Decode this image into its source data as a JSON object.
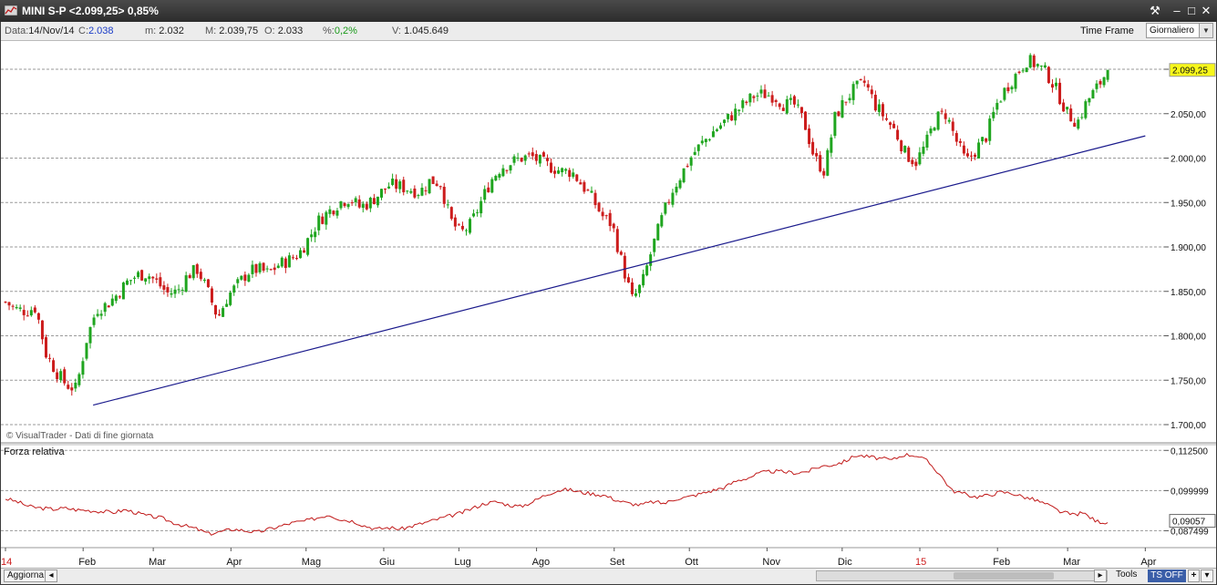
{
  "window": {
    "title": "MINI S-P <2.099,25> 0,85%",
    "buttons": [
      "tools-icon",
      "minimize-icon",
      "maximize-icon",
      "close-icon"
    ]
  },
  "infobar": {
    "date_label": "Data:",
    "date": "14/Nov/14",
    "close_label": "C:",
    "close": "2.038",
    "min_label": "m:",
    "min": "2.032",
    "max_label": "M:",
    "max": "2.039,75",
    "open_label": "O:",
    "open": "2.033",
    "pct_label": "%:",
    "pct": "0,2%",
    "vol_label": "V:",
    "vol": "1.045.649",
    "timeframe_label": "Time Frame",
    "timeframe_value": "Giornaliero"
  },
  "bottombar": {
    "refresh_label": "Aggiorna",
    "tools_label": "Tools",
    "ts_label": "TS OFF",
    "plus_label": "+",
    "menu_label": "▾"
  },
  "colors": {
    "up": "#1fa51f",
    "down": "#cc1c1c",
    "trendline": "#1a1a8c",
    "rs_line": "#c01818",
    "last_price_bg": "#f7f71a",
    "grid": "#9a9a9a"
  },
  "chart_data": [
    {
      "type": "candlestick",
      "watermark": "© VisualTrader - Dati di fine giornata",
      "ylim": [
        1700,
        2120
      ],
      "yticks": [
        "2.100,00",
        "2.050,00",
        "2.000,00",
        "1.950,00",
        "1.900,00",
        "1.850,00",
        "1.800,00",
        "1.750,00",
        "1.700,00"
      ],
      "ytick_values": [
        2100,
        2050,
        2000,
        1950,
        1900,
        1850,
        1800,
        1750,
        1700
      ],
      "last_price": 2099.25,
      "last_price_label": "2.099,25",
      "xticks": [
        "14",
        "Feb",
        "Mar",
        "Apr",
        "Mag",
        "Giu",
        "Lug",
        "Ago",
        "Set",
        "Ott",
        "Nov",
        "Dic",
        "15",
        "Feb",
        "Mar",
        "Apr"
      ],
      "xtick_highlight": [
        "14",
        "15"
      ],
      "trendline": {
        "from_date": "2014-02-05",
        "from": 1722,
        "to_date": "2015-04-01",
        "to": 2025
      },
      "closes_weekly": [
        1838,
        1830,
        1828,
        1832,
        1780,
        1760,
        1745,
        1740,
        1795,
        1830,
        1835,
        1846,
        1860,
        1868,
        1870,
        1860,
        1848,
        1850,
        1868,
        1875,
        1850,
        1820,
        1845,
        1858,
        1872,
        1875,
        1870,
        1880,
        1885,
        1892,
        1910,
        1930,
        1940,
        1950,
        1955,
        1945,
        1950,
        1960,
        1970,
        1968,
        1965,
        1962,
        1975,
        1972,
        1930,
        1915,
        1925,
        1950,
        1975,
        1990,
        1995,
        2000,
        2002,
        1995,
        1990,
        1985,
        1985,
        1970,
        1955,
        1935,
        1925,
        1880,
        1840,
        1860,
        1900,
        1935,
        1965,
        1985,
        2005,
        2018,
        2030,
        2040,
        2050,
        2060,
        2070,
        2072,
        2070,
        2060,
        2060,
        2040,
        2000,
        1985,
        2045,
        2065,
        2078,
        2085,
        2060,
        2045,
        2030,
        2005,
        1995,
        2015,
        2045,
        2050,
        2020,
        1995,
        2010,
        2025,
        2060,
        2080,
        2095,
        2110,
        2105,
        2095,
        2075,
        2050,
        2040,
        2065,
        2080,
        2099.25
      ]
    },
    {
      "type": "line",
      "title": "Forza relativa",
      "ylim": [
        0.0845,
        0.114
      ],
      "yticks": [
        "0,112500",
        "0,099999",
        "0,087499"
      ],
      "ytick_values": [
        0.1125,
        0.099999,
        0.087499
      ],
      "last_value": 0.09057,
      "last_value_label": "0,09057",
      "series": [
        {
          "values": [
            0.0975,
            0.0965,
            0.095,
            0.0945,
            0.0942,
            0.0945,
            0.094,
            0.0938,
            0.0935,
            0.0932,
            0.094,
            0.093,
            0.092,
            0.0915,
            0.09,
            0.089,
            0.088,
            0.0865,
            0.0872,
            0.088,
            0.0875,
            0.087,
            0.088,
            0.089,
            0.09,
            0.0905,
            0.0915,
            0.0925,
            0.091,
            0.0905,
            0.089,
            0.088,
            0.0885,
            0.088,
            0.089,
            0.09,
            0.091,
            0.092,
            0.093,
            0.0945,
            0.096,
            0.0965,
            0.0955,
            0.095,
            0.0965,
            0.0985,
            0.1,
            0.1003,
            0.0995,
            0.099,
            0.0985,
            0.097,
            0.096,
            0.0955,
            0.0965,
            0.096,
            0.0975,
            0.098,
            0.099,
            0.1,
            0.101,
            0.103,
            0.104,
            0.1055,
            0.106,
            0.1058,
            0.1055,
            0.106,
            0.1075,
            0.108,
            0.109,
            0.111,
            0.1105,
            0.11,
            0.1095,
            0.1112,
            0.111,
            0.109,
            0.105,
            0.1,
            0.099,
            0.098,
            0.0985,
            0.0995,
            0.0992,
            0.098,
            0.097,
            0.0955,
            0.0935,
            0.0925,
            0.093,
            0.0905,
            0.09
          ]
        }
      ]
    }
  ]
}
